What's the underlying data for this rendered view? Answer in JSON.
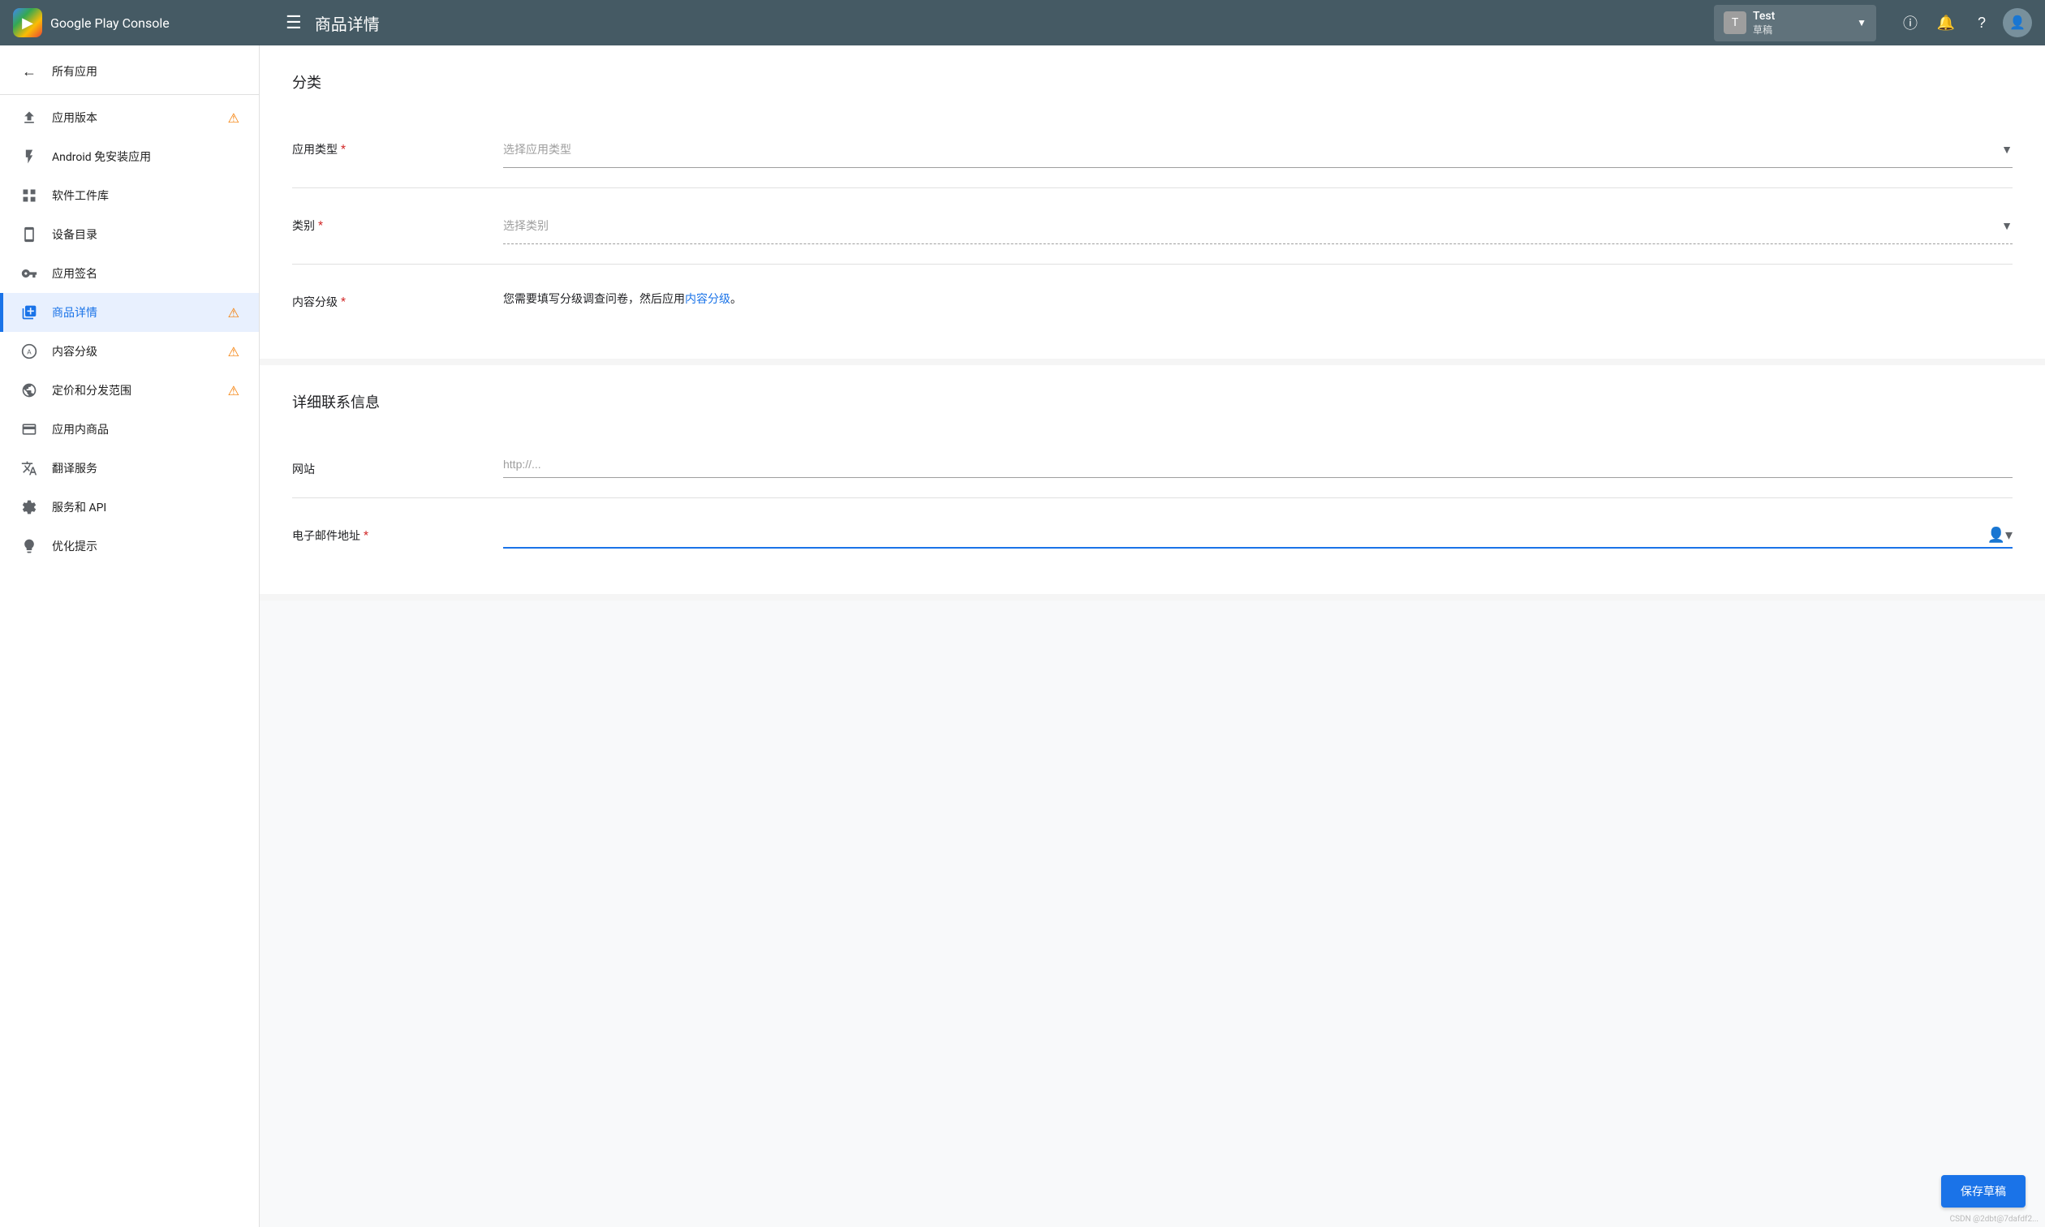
{
  "header": {
    "logo_text": "Google Play Console",
    "menu_icon": "☰",
    "page_title": "商品详情",
    "app_name": "Test",
    "app_status": "草稿",
    "info_icon": "ⓘ",
    "notification_icon": "🔔",
    "help_icon": "?",
    "avatar_icon": "👤",
    "chevron_icon": "▼"
  },
  "sidebar": {
    "items": [
      {
        "id": "all-apps",
        "label": "所有应用",
        "icon": "←",
        "warning": false
      },
      {
        "id": "app-version",
        "label": "应用版本",
        "icon": "⬆",
        "warning": true
      },
      {
        "id": "android-instant",
        "label": "Android 免安装应用",
        "icon": "⚡",
        "warning": false
      },
      {
        "id": "software-lib",
        "label": "软件工件库",
        "icon": "▦",
        "warning": false
      },
      {
        "id": "device-catalog",
        "label": "设备目录",
        "icon": "☰",
        "warning": false
      },
      {
        "id": "app-signing",
        "label": "应用签名",
        "icon": "🔑",
        "warning": false
      },
      {
        "id": "store-listing",
        "label": "商品详情",
        "icon": "▶",
        "warning": true,
        "active": true
      },
      {
        "id": "content-rating",
        "label": "内容分级",
        "icon": "⊙",
        "warning": true
      },
      {
        "id": "pricing",
        "label": "定价和分发范围",
        "icon": "⊕",
        "warning": true
      },
      {
        "id": "in-app-products",
        "label": "应用内商品",
        "icon": "▬",
        "warning": false
      },
      {
        "id": "translation",
        "label": "翻译服务",
        "icon": "A",
        "warning": false
      },
      {
        "id": "services-api",
        "label": "服务和 API",
        "icon": "◎",
        "warning": false
      },
      {
        "id": "optimize",
        "label": "优化提示",
        "icon": "☆",
        "warning": false
      }
    ]
  },
  "main": {
    "section_category": {
      "title": "分类",
      "fields": [
        {
          "id": "app-type",
          "label": "应用类型",
          "required": true,
          "type": "select",
          "placeholder": "选择应用类型",
          "dashed": false
        },
        {
          "id": "category",
          "label": "类别",
          "required": true,
          "type": "select",
          "placeholder": "选择类别",
          "dashed": true
        },
        {
          "id": "content-rating",
          "label": "内容分级",
          "required": true,
          "type": "text",
          "text_before": "您需要填写分级调查问卷，然后应用",
          "link_text": "内容分级",
          "text_after": "。"
        }
      ]
    },
    "section_contact": {
      "title": "详细联系信息",
      "fields": [
        {
          "id": "website",
          "label": "网站",
          "required": false,
          "type": "input",
          "placeholder": "http://..."
        },
        {
          "id": "email",
          "label": "电子邮件地址",
          "required": true,
          "type": "email",
          "placeholder": ""
        }
      ]
    }
  },
  "buttons": {
    "save_draft": "保存草稿"
  },
  "watermark": "CSDN @2dbt@7dafdf2..."
}
